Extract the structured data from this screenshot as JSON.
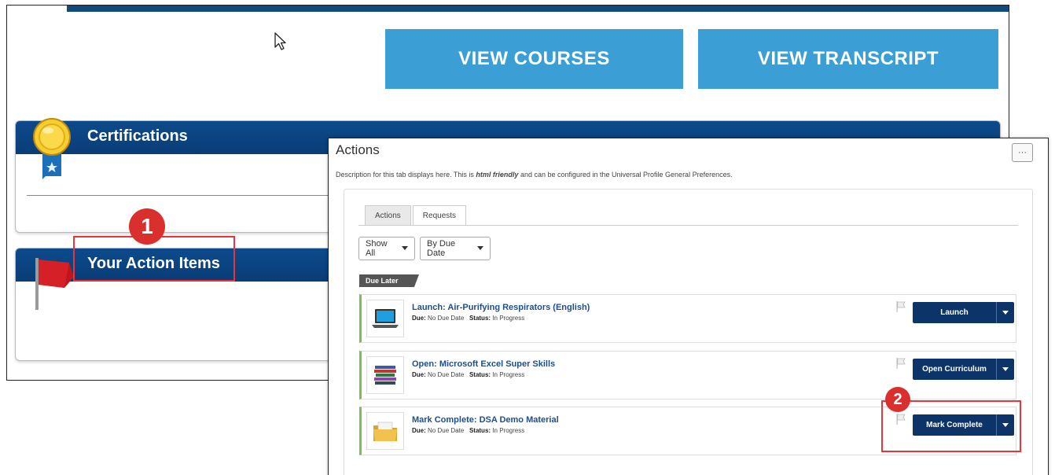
{
  "background": {
    "view_courses": "VIEW COURSES",
    "view_transcript": "VIEW TRANSCRIPT",
    "certifications_title": "Certifications",
    "action_items_title": "Your Action Items"
  },
  "callouts": {
    "one": "1",
    "two": "2"
  },
  "actions_panel": {
    "title": "Actions",
    "more_label": "···",
    "description_pre": "Description for this tab displays here. This is ",
    "description_em": "html friendly",
    "description_post": " and can be configured in the Universal Profile General Preferences.",
    "tabs": [
      {
        "label": "Actions",
        "active": true
      },
      {
        "label": "Requests",
        "active": false
      }
    ],
    "filters": {
      "show": "Show All",
      "sort": "By Due Date"
    },
    "group_label": "Due Later",
    "items": [
      {
        "title": "Launch: Air-Purifying Respirators (English)",
        "due_label": "Due:",
        "due": "No Due Date",
        "status_label": "Status:",
        "status": "In Progress",
        "action": "Launch",
        "icon": "laptop-icon"
      },
      {
        "title": "Open: Microsoft Excel Super Skills",
        "due_label": "Due:",
        "due": "No Due Date",
        "status_label": "Status:",
        "status": "In Progress",
        "action": "Open Curriculum",
        "icon": "books-icon"
      },
      {
        "title": "Mark Complete: DSA Demo Material",
        "due_label": "Due:",
        "due": "No Due Date",
        "status_label": "Status:",
        "status": "In Progress",
        "action": "Mark Complete",
        "icon": "folder-icon"
      }
    ]
  },
  "colors": {
    "brand_blue": "#0c4a8c",
    "button_blue": "#3b9ed4",
    "action_navy": "#0d3468",
    "callout_red": "#e8343a"
  }
}
